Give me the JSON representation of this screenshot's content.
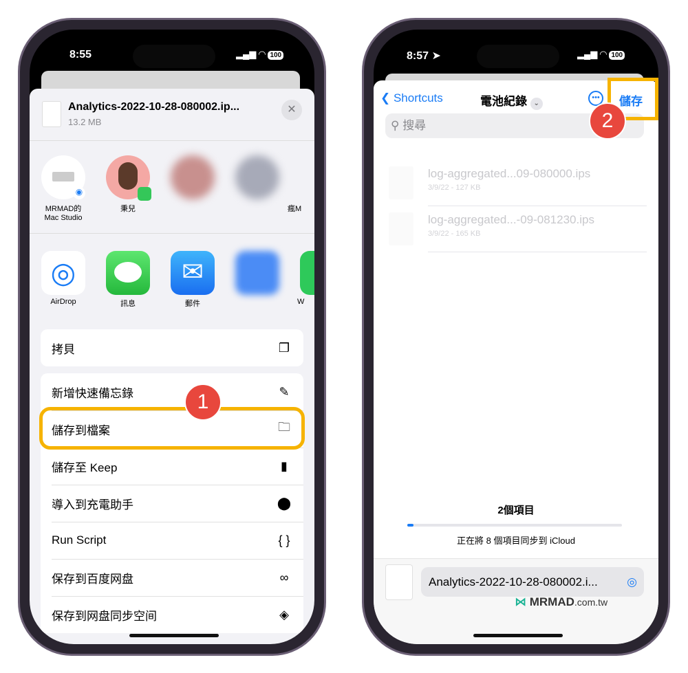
{
  "colors": {
    "accent": "#1a7cf5",
    "highlight": "#f6b300",
    "badge": "#e8473d"
  },
  "left": {
    "status": {
      "time": "8:55",
      "battery": "100"
    },
    "file": {
      "name": "Analytics-2022-10-28-080002.ip...",
      "size": "13.2 MB"
    },
    "people": [
      {
        "name": "MRMAD的\nMac Studio"
      },
      {
        "name": "秉兒"
      },
      {
        "name": ""
      },
      {
        "name": ""
      },
      {
        "name": "瘋M"
      }
    ],
    "apps": [
      {
        "name": "AirDrop",
        "icon": "airdrop-icon"
      },
      {
        "name": "訊息",
        "icon": "messages-icon"
      },
      {
        "name": "郵件",
        "icon": "mail-icon"
      },
      {
        "name": ""
      },
      {
        "name": "W"
      }
    ],
    "copy": {
      "label": "拷貝",
      "icon": "copy-icon"
    },
    "actions": [
      {
        "label": "新增快速備忘錄",
        "icon": "quick-note-icon",
        "glyph": "✎"
      },
      {
        "label": "儲存到檔案",
        "icon": "folder-icon",
        "glyph": "🗀"
      },
      {
        "label": "儲存至 Keep",
        "icon": "bookmark-icon",
        "glyph": "▮"
      },
      {
        "label": "導入到充電助手",
        "icon": "search-circle-icon",
        "glyph": "⬤"
      },
      {
        "label": "Run Script",
        "icon": "braces-icon",
        "glyph": "{ }"
      },
      {
        "label": "保存到百度网盘",
        "icon": "baidu-icon",
        "glyph": "∞"
      },
      {
        "label": "保存到网盘同步空间",
        "icon": "sync-icon",
        "glyph": "◈"
      }
    ],
    "step_badge": "1"
  },
  "right": {
    "status": {
      "time": "8:57",
      "battery": "100"
    },
    "nav": {
      "back": "Shortcuts",
      "title": "電池紀錄",
      "save": "儲存"
    },
    "search": {
      "placeholder": "搜尋"
    },
    "files": [
      {
        "name": "log-aggregated...09-080000.ips",
        "meta": "3/9/22 - 127 KB"
      },
      {
        "name": "log-aggregated...-09-081230.ips",
        "meta": "3/9/22 - 165 KB"
      }
    ],
    "count": "2個項目",
    "sync": {
      "text": "正在將 8 個項目同步到 iCloud",
      "progress_percent": 3
    },
    "filename": "Analytics-2022-10-28-080002.i...",
    "step_badge": "2"
  },
  "watermark": "MRMAD.com.tw"
}
